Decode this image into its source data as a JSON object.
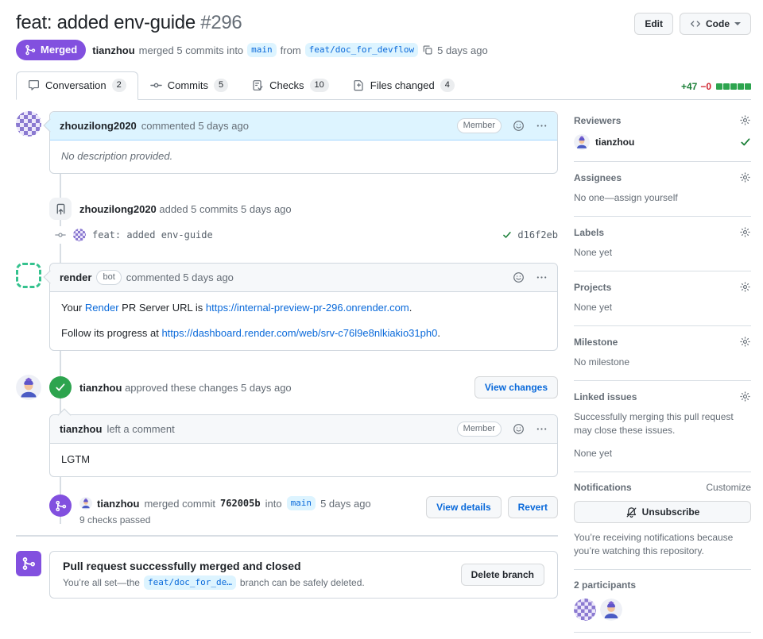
{
  "page": {
    "title": "feat: added env-guide",
    "number": "#296"
  },
  "header": {
    "edit_button": "Edit",
    "code_button": "Code",
    "status_badge": "Merged",
    "author": "tianzhou",
    "merged_text": "merged 5 commits into",
    "base_branch": "main",
    "from_text": "from",
    "head_branch": "feat/doc_for_devflow",
    "time": "5 days ago"
  },
  "tabs": [
    {
      "label": "Conversation",
      "count": "2"
    },
    {
      "label": "Commits",
      "count": "5"
    },
    {
      "label": "Checks",
      "count": "10"
    },
    {
      "label": "Files changed",
      "count": "4"
    }
  ],
  "diffstat": {
    "additions": "+47",
    "deletions": "−0",
    "blocks": 5
  },
  "timeline": {
    "op_comment": {
      "author": "zhouzilong2020",
      "meta": "commented 5 days ago",
      "member_badge": "Member",
      "body": "No description provided."
    },
    "commits_event": {
      "author": "zhouzilong2020",
      "meta": "added 5 commits 5 days ago"
    },
    "commit_row": {
      "message": "feat: added env-guide",
      "sha": "d16f2eb"
    },
    "bot_comment": {
      "author": "render",
      "bot_badge": "bot",
      "meta": "commented 5 days ago",
      "line1_prefix": "Your",
      "line1_render_link": "Render",
      "line1_middle": "PR Server URL is",
      "line1_url": "https://internal-preview-pr-296.onrender.com",
      "line1_suffix": ".",
      "line2_prefix": "Follow its progress at",
      "line2_url": "https://dashboard.render.com/web/srv-c76l9e8nlkiakio31ph0",
      "line2_suffix": "."
    },
    "approval": {
      "author": "tianzhou",
      "meta": "approved these changes 5 days ago",
      "view_changes_button": "View changes"
    },
    "review_comment": {
      "author": "tianzhou",
      "meta": "left a comment",
      "member_badge": "Member",
      "body": "LGTM"
    },
    "merge_event": {
      "author": "tianzhou",
      "text_merged_commit": "merged commit",
      "sha": "762005b",
      "text_into": "into",
      "branch": "main",
      "time": "5 days ago",
      "checks_summary": "9 checks passed",
      "view_details_button": "View details",
      "revert_button": "Revert"
    },
    "merged_box": {
      "title": "Pull request successfully merged and closed",
      "text_prefix": "You’re all set—the",
      "branch": "feat/doc_for_de…",
      "text_suffix": "branch can be safely deleted.",
      "delete_branch_button": "Delete branch"
    }
  },
  "sidebar": {
    "reviewers": {
      "title": "Reviewers",
      "name": "tianzhou"
    },
    "assignees": {
      "title": "Assignees",
      "empty": "No one—assign yourself"
    },
    "labels": {
      "title": "Labels",
      "empty": "None yet"
    },
    "projects": {
      "title": "Projects",
      "empty": "None yet"
    },
    "milestone": {
      "title": "Milestone",
      "empty": "No milestone"
    },
    "linked_issues": {
      "title": "Linked issues",
      "description": "Successfully merging this pull request may close these issues.",
      "empty": "None yet"
    },
    "notifications": {
      "title": "Notifications",
      "customize_link": "Customize",
      "unsubscribe_button": "Unsubscribe",
      "description": "You’re receiving notifications because you’re watching this repository."
    },
    "participants": {
      "title": "2 participants"
    }
  },
  "colors": {
    "merged_purple": "#8250df",
    "link_blue": "#0969da",
    "success_green": "#2da44e",
    "diff_add_green": "#1a7f37",
    "diff_del_red": "#cf222e",
    "op_header_blue": "#ddf4ff"
  }
}
